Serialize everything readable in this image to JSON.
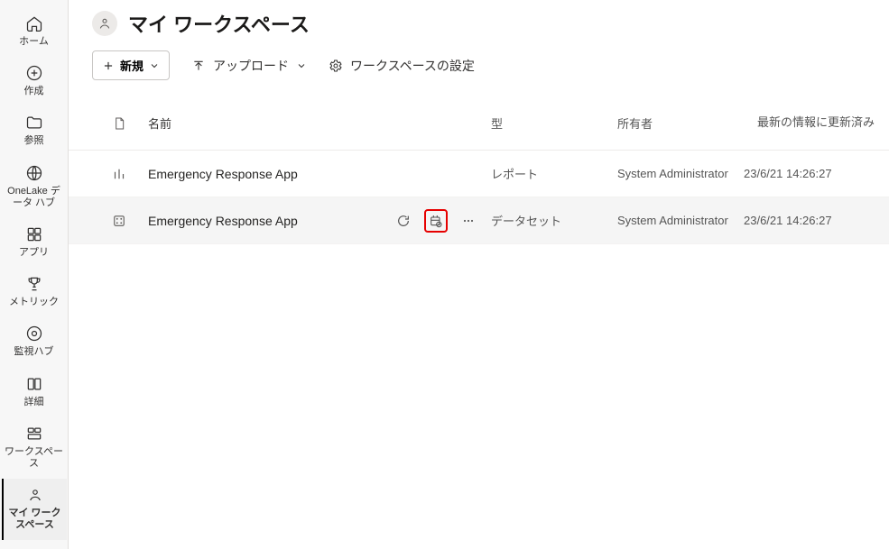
{
  "sidebar": {
    "items": [
      {
        "label": "ホーム"
      },
      {
        "label": "作成"
      },
      {
        "label": "参照"
      },
      {
        "label": "OneLake データ ハブ"
      },
      {
        "label": "アプリ"
      },
      {
        "label": "メトリック"
      },
      {
        "label": "監視ハブ"
      },
      {
        "label": "詳細"
      },
      {
        "label": "ワークスペース"
      },
      {
        "label": "マイ ワークスペース"
      }
    ]
  },
  "header": {
    "title": "マイ ワークスペース"
  },
  "toolbar": {
    "new_label": "新規",
    "upload_label": "アップロード",
    "settings_label": "ワークスペースの設定"
  },
  "table": {
    "columns": {
      "name": "名前",
      "type": "型",
      "owner": "所有者",
      "refreshed": "最新の情報に更新済み"
    },
    "rows": [
      {
        "name": "Emergency Response App",
        "type": "レポート",
        "owner": "System Administrator",
        "refreshed": "23/6/21 14:26:27",
        "icon": "report"
      },
      {
        "name": "Emergency Response App",
        "type": "データセット",
        "owner": "System Administrator",
        "refreshed": "23/6/21 14:26:27",
        "icon": "dataset"
      }
    ]
  }
}
